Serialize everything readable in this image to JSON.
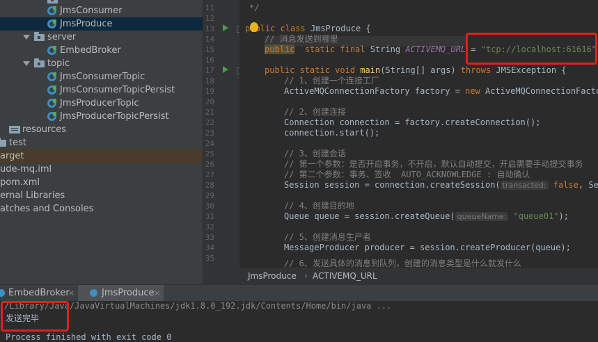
{
  "project_tree": {
    "items": [
      {
        "label": "JmsConsumer"
      },
      {
        "label": "JmsProduce"
      },
      {
        "label": "server"
      },
      {
        "label": "EmbedBroker"
      },
      {
        "label": "topic"
      },
      {
        "label": "JmsConsumerTopic"
      },
      {
        "label": "JmsConsumerTopicPersist"
      },
      {
        "label": "JmsProducerTopic"
      },
      {
        "label": "JmsProducerTopicPersist"
      },
      {
        "label": "resources"
      },
      {
        "label": "test"
      },
      {
        "label": "arget"
      },
      {
        "label": "ude-mq.iml"
      },
      {
        "label": "pom.xml"
      },
      {
        "label": "ernal Libraries"
      },
      {
        "label": "atches and Consoles"
      }
    ]
  },
  "editor": {
    "line_numbers": [
      "11",
      "12",
      "13",
      "14",
      "15",
      "16",
      "17",
      "18",
      "19",
      "20",
      "21",
      "22",
      "23",
      "24",
      "25",
      "26",
      "27",
      "28",
      "29",
      "30",
      "31",
      "32",
      "33",
      "34",
      "35"
    ],
    "lines": {
      "l11": "*/",
      "l14_comment": "// 消息发送到哪里",
      "l15_kw1": "public",
      "l15_kw2": "static final",
      "l15_type": "String",
      "l15_field": "ACTIVEMQ_URL",
      "l15_eq": " = ",
      "l15_str": "\"tcp://localhost:61616\"",
      "l15_semi": ";",
      "l13_kw": "public class",
      "l13_name": "JmsProduce {",
      "l17_kw": "public static void",
      "l17_fn": "main",
      "l17_args": "(String[] args)",
      "l17_throws": "throws",
      "l17_exc": "JMSException {",
      "l18": "// 1、创建一个连接工厂",
      "l19_a": "ActiveMQConnectionFactory factory = ",
      "l19_kw": "new",
      "l19_b": " ActiveMQConnectionFactory(",
      "l21": "// 2、创建连接",
      "l22": "Connection connection = factory.createConnection();",
      "l23": "connection.start();",
      "l25": "// 3、创建会话",
      "l26": "// 第一个参数：是否开启事务，不开启，默认自动提交，开启需要手动提交事务",
      "l27": "// 第二个参数：事务、签收  AUTO_ACKNOWLEDGE : 自动确认",
      "l28_a": "Session session = connection.createSession(",
      "l28_hint": "transacted:",
      "l28_kw": " false",
      "l28_b": ", Sess",
      "l30": "// 4、创建目的地",
      "l31_a": "Queue queue = session.createQueue(",
      "l31_hint": "queueName:",
      "l31_str": " \"queue01\"",
      "l31_b": ");",
      "l33": "// 5、创建消息生产者",
      "l34": "MessageProducer producer = session.createProducer(queue);",
      "l35": "// 6、发送具体的消息到队列，创建的消息类型是什么就发什么"
    }
  },
  "breadcrumb": {
    "class": "JmsProduce",
    "field": "ACTIVEMQ_URL"
  },
  "run_panel": {
    "tabs": [
      {
        "label": "EmbedBroker"
      },
      {
        "label": "JmsProduce"
      }
    ],
    "console": {
      "cmd": "/Library/Java/JavaVirtualMachines/jdk1.8.0_192.jdk/Contents/Home/bin/java ...",
      "output": "发送完毕",
      "exit": "Process finished with exit code 0"
    }
  },
  "colors": {
    "annotation_box": "#e02020",
    "keyword": "#cc7832",
    "string": "#6a8759",
    "comment": "#808080"
  }
}
